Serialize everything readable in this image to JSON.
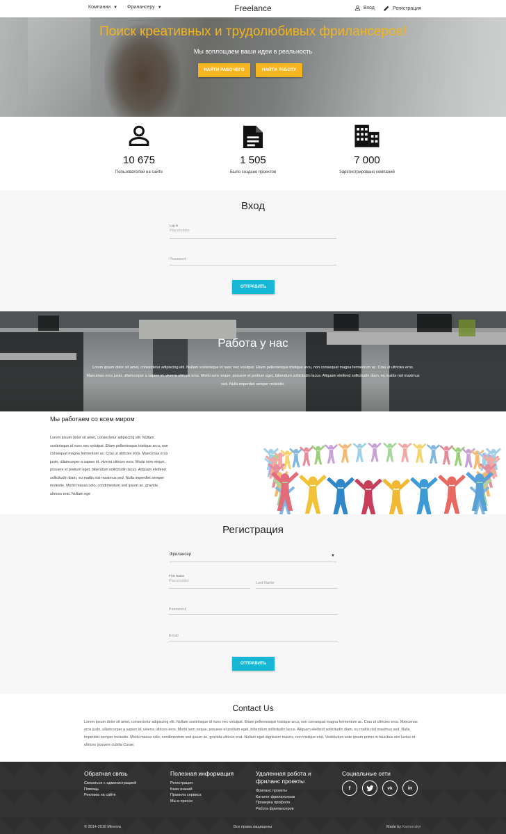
{
  "nav": {
    "companies": "Компании",
    "freelancers": "Фрилансеру",
    "brand": "Freelance",
    "login": "Вход",
    "register": "Регистрация"
  },
  "hero": {
    "title": "Поиск креативных и трудолюбивых фрилансеров!",
    "subtitle": "Мы воплощаем ваши идеи в реальность",
    "btn_find_worker": "НАЙТИ РАБОЧЕГО",
    "btn_find_job": "НАЙТИ РАБОТУ"
  },
  "stats": [
    {
      "icon": "user-icon",
      "value": "10 675",
      "label": "Пользователей на сайте"
    },
    {
      "icon": "document-icon",
      "value": "1 505",
      "label": "Было создано проектов"
    },
    {
      "icon": "building-icon",
      "value": "7 000",
      "label": "Зарегистрировано компаний"
    }
  ],
  "login": {
    "title": "Вход",
    "login_label": "Log in",
    "login_placeholder": "Placeholder",
    "password_placeholder": "Password",
    "submit": "ОТПРАВИТЬ"
  },
  "work": {
    "title": "Работа у нас",
    "text": "Lorem ipsum dolor sit amet, consectetur adipiscing elit. Nullam scelerisque id nunc nec volutpat. Etiam pellentesque tristique arcu, non consequat magna fermentum ac. Cras ut ultricies eros. Maecenas eros justo, ullamcorper a sapien id, viverra ultrices eros. Morbi sem neque, posuere et pretium eget, bibendum sollicitudin lacus. Aliquam eleifend sollicitudin diam, eu mattis nisl maximus sed. Nulla imperdiet semper molestie."
  },
  "world": {
    "title": "Мы работаем со всем миром",
    "text": "Lorem ipsum dolor sit amet, consectetur adipiscing elit. Nullam scelerisque id nunc nec volutpat. Etiam pellentesque tristique arcu, non consequat magna fermentum ac. Cras ut ultricies eros. Maecenas eros justo, ullamcorper a sapien id, viverra ultrices eros. Morbi sem neque, posuere et pretium eget, bibendum sollicitudin lacus. Aliquam eleifend sollicitudin diam, eu mattis nisl maximus sed. Nulla imperdiet semper molestie. Morbi massa odio, condimentum sed ipsum ac, gravida ultrices erat. Nullam ege"
  },
  "register": {
    "title": "Регистрация",
    "role_selected": "Фрилансер",
    "first_name_label": "First Name",
    "first_name_placeholder": "Placeholder",
    "last_name_placeholder": "Last Name",
    "password_placeholder": "Password",
    "email_placeholder": "Email",
    "submit": "ОТПРАВИТЬ"
  },
  "contact": {
    "title": "Contact Us",
    "text": "Lorem ipsum dolor sit amet, consectetur adipiscing elit. Nullam scelerisque id nunc nec volutpat. Etiam pellentesque tristique arcu, non consequat magna fermentum ac. Cras ut ultricies eros. Maecenas eros justo, ullamcorper a sapien id, viverra ultrices eros. Morbi sem neque, posuere et pretium eget, bibendum sollicitudin lacus. Aliquam eleifend sollicitudin diam, eu mattis nisl maximus sed. Nulla imperdiet semper molestie. Morbi massa odio, condimentum sed ipsum ac, gravida ultrices erat. Nullam eget dignissim mauris, non tristique erat. Vestibulum ante ipsum primis in faucibus orci luctus et ultrices posuere cubilia Curae;"
  },
  "footer": {
    "feedback_title": "Обратная связь",
    "feedback_items": [
      "Связаться с администрацией",
      "Помощь",
      "Реклама на сайте"
    ],
    "info_title": "Полезная информация",
    "info_items": [
      "Регистрация",
      "База знаний",
      "Правила сервиса",
      "Мы в прессе"
    ],
    "remote_title": "Удаленная работа и фриланс проекты",
    "remote_items": [
      "Фриланс проекты",
      "Каталог фрилансеров",
      "Проверка профиля",
      "Работа фрилансеров"
    ],
    "social_title": "Социальные сети",
    "social": [
      "f",
      "t",
      "vk",
      "in"
    ],
    "copyright": "© 2014-2016 Minerva",
    "rights": "Все права защищены",
    "made_by_prefix": "Made by",
    "made_by": "Kamenskyi"
  },
  "colors": {
    "accent_yellow": "#f6b521",
    "button_cyan": "#15b6d6",
    "footer_bg": "#333333"
  }
}
